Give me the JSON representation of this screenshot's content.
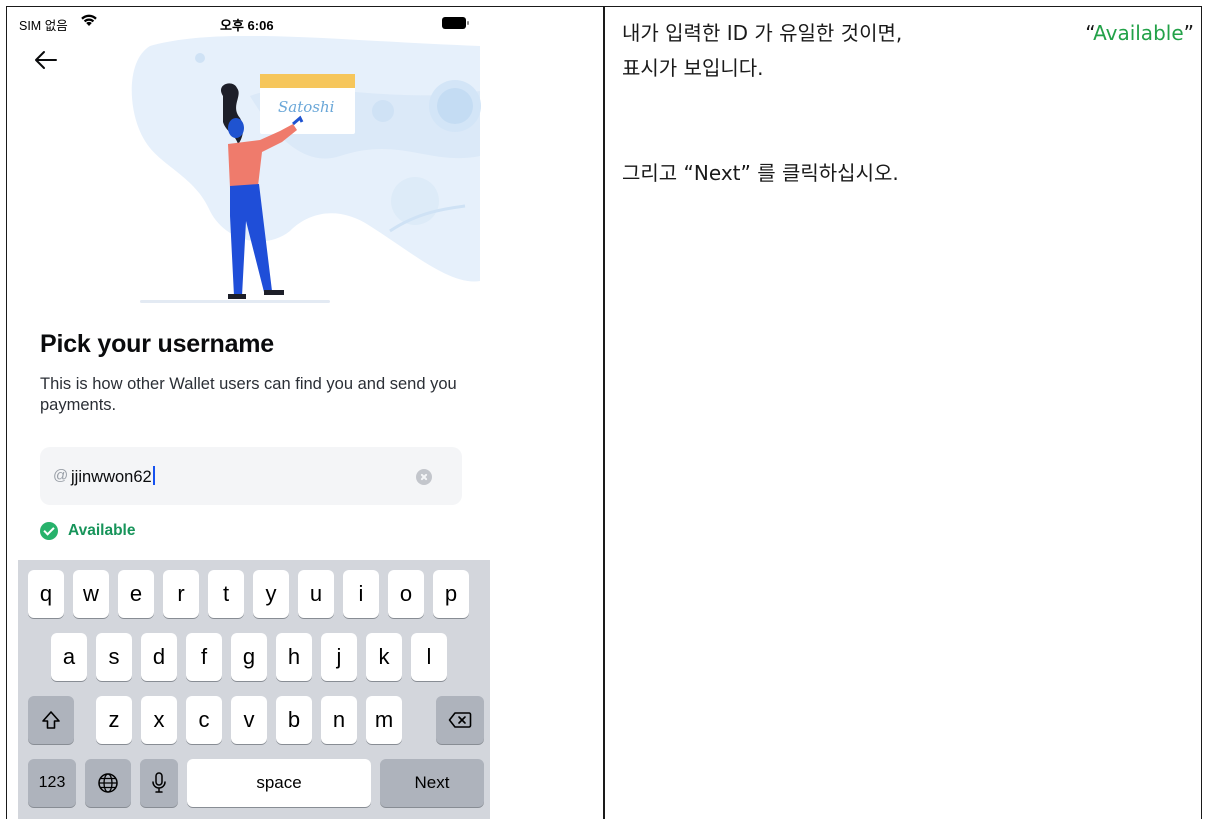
{
  "status_bar": {
    "carrier": "SIM 없음",
    "time": "오후 6:06"
  },
  "hero": {
    "card_text": "Satoshi"
  },
  "page": {
    "title": "Pick your username",
    "subtitle": "This is how other Wallet users can find you and send you payments."
  },
  "username_field": {
    "prefix": "@",
    "value": "jjinwwon62"
  },
  "availability": {
    "label": "Available",
    "color": "#27b26b"
  },
  "keyboard": {
    "row1": [
      "q",
      "w",
      "e",
      "r",
      "t",
      "y",
      "u",
      "i",
      "o",
      "p"
    ],
    "row2": [
      "a",
      "s",
      "d",
      "f",
      "g",
      "h",
      "j",
      "k",
      "l"
    ],
    "row3": [
      "z",
      "x",
      "c",
      "v",
      "b",
      "n",
      "m"
    ],
    "numbers_key": "123",
    "space_key": "space",
    "return_key": "Next"
  },
  "instructions": {
    "line1_before": "내가 입력한 ID 가 유일한 것이면,",
    "line1_quote_open": "“",
    "line1_green": "Available",
    "line1_quote_close": "”",
    "line2": "표시가 보입니다.",
    "line3": "그리고 “Next” 를 클릭하십시오.",
    "highlight_color": "#22a148"
  }
}
